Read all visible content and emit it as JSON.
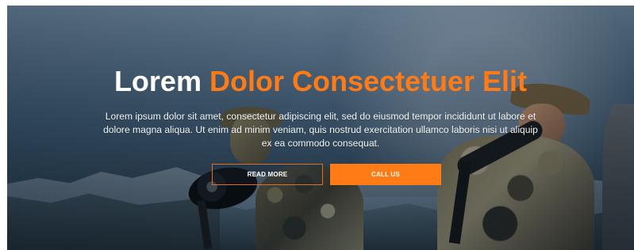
{
  "hero": {
    "title_white": "Lorem",
    "title_accent": "Dolor Consectetuer Elit",
    "description": "Lorem ipsum dolor sit amet, consectetur adipiscing elit, sed do eiusmod tempor incididunt ut labore et dolore magna aliqua. Ut enim ad minim veniam, quis nostrud exercitation ullamco laboris nisi ut aliquip ex ea commodo consequat."
  },
  "buttons": {
    "read_more": "READ MORE",
    "call_us": "CALL US"
  },
  "colors": {
    "accent": "#FF7B16",
    "text_primary": "#FFFFFF",
    "overlay_dark": "#2B3B46"
  }
}
